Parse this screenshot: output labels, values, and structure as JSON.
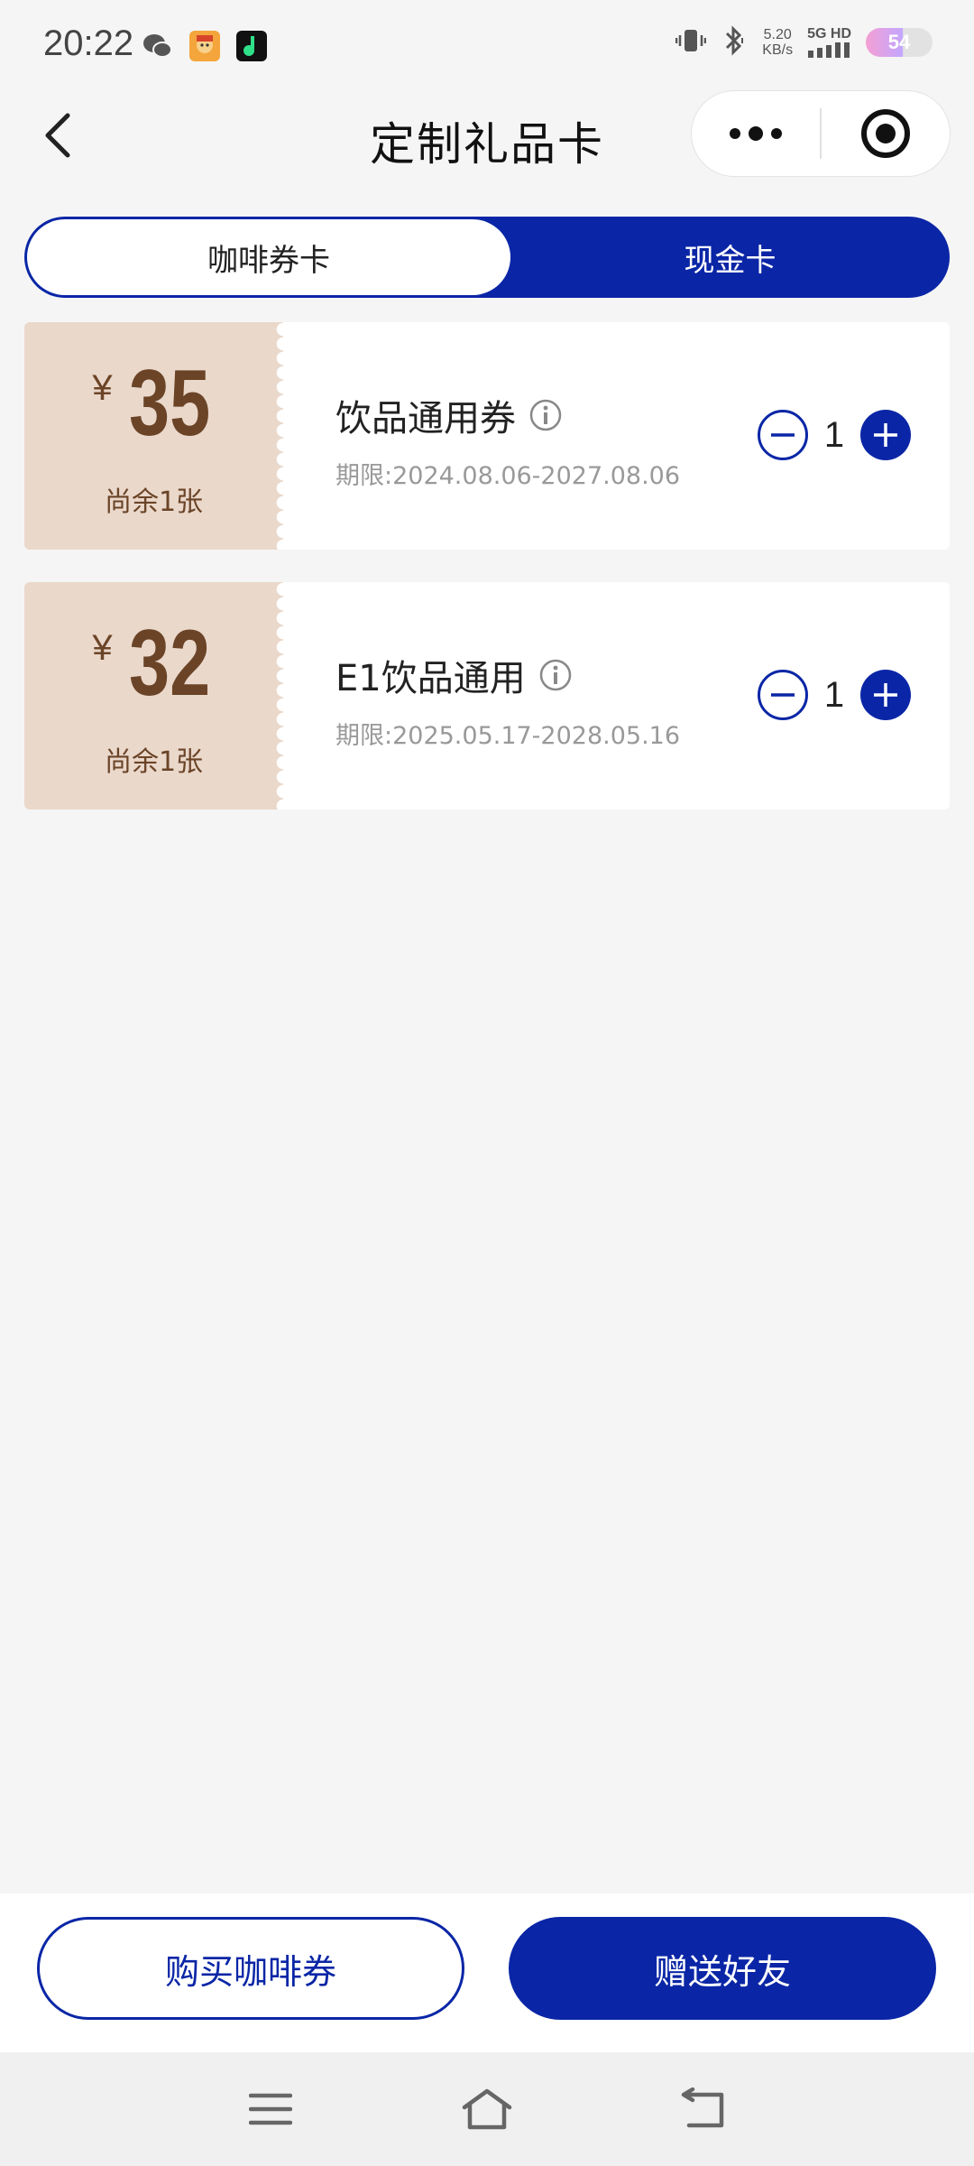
{
  "status_bar": {
    "time": "20:22",
    "network_speed_value": "5.20",
    "network_speed_unit": "KB/s",
    "signal_label": "5G HD",
    "battery": "54"
  },
  "header": {
    "title": "定制礼品卡"
  },
  "tabs": [
    {
      "label": "咖啡券卡",
      "active": true
    },
    {
      "label": "现金卡",
      "active": false
    }
  ],
  "coupons": [
    {
      "currency": "¥",
      "amount": "35",
      "remaining": "尚余1张",
      "name": "饮品通用券",
      "validity": "期限:2024.08.06-2027.08.06",
      "quantity": "1"
    },
    {
      "currency": "¥",
      "amount": "32",
      "remaining": "尚余1张",
      "name": "E1饮品通用",
      "validity": "期限:2025.05.17-2028.05.16",
      "quantity": "1"
    }
  ],
  "actions": {
    "buy_label": "购买咖啡券",
    "gift_label": "赠送好友"
  },
  "colors": {
    "primary": "#0a26a6",
    "stub": "#ead8cb",
    "price_text": "#6b4427",
    "background": "#f5f5f5"
  }
}
